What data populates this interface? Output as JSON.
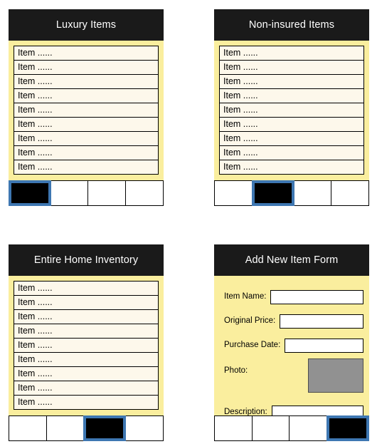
{
  "app": {
    "type": "mobile-app-wireframe-mockup",
    "background_color": "#ffffff",
    "header_color": "#1a1a1a",
    "body_color": "#faee9e",
    "row_color": "#fdf8eb",
    "selected_tab_border_color": "#3e77b2",
    "selected_tab_fill_color": "#000000",
    "photo_placeholder_color": "#919191"
  },
  "screens": [
    {
      "id": "luxury-items",
      "title": "Luxury Items",
      "type": "list",
      "items": [
        "Item ......",
        "Item ......",
        "Item ......",
        "Item ......",
        "Item ......",
        "Item ......",
        "Item ......",
        "Item ......",
        "Item ......"
      ],
      "tabs": [
        {
          "label": "",
          "selected": true
        },
        {
          "label": "",
          "selected": false
        },
        {
          "label": "",
          "selected": false
        },
        {
          "label": "",
          "selected": false
        }
      ]
    },
    {
      "id": "non-insured-items",
      "title": "Non-insured Items",
      "type": "list",
      "items": [
        "Item ......",
        "Item ......",
        "Item ......",
        "Item ......",
        "Item ......",
        "Item ......",
        "Item ......",
        "Item ......",
        "Item ......"
      ],
      "tabs": [
        {
          "label": "",
          "selected": false
        },
        {
          "label": "",
          "selected": true
        },
        {
          "label": "",
          "selected": false
        },
        {
          "label": "",
          "selected": false
        }
      ]
    },
    {
      "id": "entire-home-inventory",
      "title": "Entire Home Inventory",
      "type": "list",
      "items": [
        "Item ......",
        "Item ......",
        "Item ......",
        "Item ......",
        "Item ......",
        "Item ......",
        "Item ......",
        "Item ......",
        "Item ......"
      ],
      "tabs": [
        {
          "label": "",
          "selected": false
        },
        {
          "label": "",
          "selected": false
        },
        {
          "label": "",
          "selected": true
        },
        {
          "label": "",
          "selected": false
        }
      ]
    },
    {
      "id": "add-new-item-form",
      "title": "Add New Item Form",
      "type": "form",
      "fields": [
        {
          "label": "Item Name:",
          "value": "",
          "control": "text"
        },
        {
          "label": "Original Price:",
          "value": "",
          "control": "text"
        },
        {
          "label": "Purchase Date:",
          "value": "",
          "control": "text"
        },
        {
          "label": "Photo:",
          "value": "",
          "control": "image"
        },
        {
          "label": "Description:",
          "value": "",
          "control": "text"
        }
      ],
      "tabs": [
        {
          "label": "",
          "selected": false
        },
        {
          "label": "",
          "selected": false
        },
        {
          "label": "",
          "selected": false
        },
        {
          "label": "",
          "selected": true
        }
      ]
    }
  ]
}
